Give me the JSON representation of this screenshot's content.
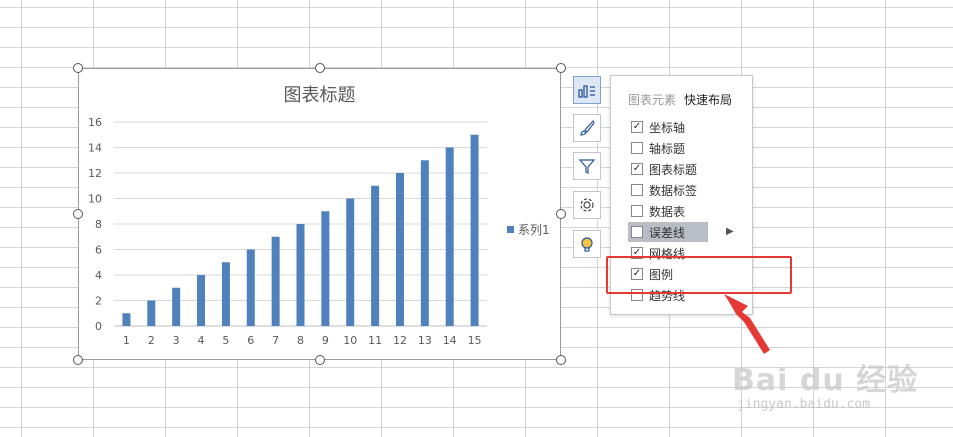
{
  "chart": {
    "title": "图表标题",
    "legend_label": "系列1"
  },
  "chart_data": {
    "type": "bar",
    "categories": [
      "1",
      "2",
      "3",
      "4",
      "5",
      "6",
      "7",
      "8",
      "9",
      "10",
      "11",
      "12",
      "13",
      "14",
      "15"
    ],
    "series": [
      {
        "name": "系列1",
        "values": [
          1,
          2,
          3,
          4,
          5,
          6,
          7,
          8,
          9,
          10,
          11,
          12,
          13,
          14,
          15
        ],
        "color": "#4f81bd"
      }
    ],
    "title": "图表标题",
    "xlabel": "",
    "ylabel": "",
    "ylim": [
      0,
      16
    ],
    "yticks": [
      0,
      2,
      4,
      6,
      8,
      10,
      12,
      14,
      16
    ],
    "grid": true,
    "legend": "right"
  },
  "side_tools": [
    {
      "name": "chart-elements-icon",
      "active": true
    },
    {
      "name": "chart-styles-brush-icon",
      "active": false
    },
    {
      "name": "chart-filter-icon",
      "active": false
    },
    {
      "name": "chart-settings-gear-icon",
      "active": false
    },
    {
      "name": "lightbulb-icon",
      "active": false
    }
  ],
  "panel": {
    "tabs": [
      {
        "label": "图表元素",
        "active": false
      },
      {
        "label": "快速布局",
        "active": true
      }
    ],
    "options": [
      {
        "label": "坐标轴",
        "checked": true
      },
      {
        "label": "轴标题",
        "checked": false
      },
      {
        "label": "图表标题",
        "checked": true
      },
      {
        "label": "数据标签",
        "checked": false
      },
      {
        "label": "数据表",
        "checked": false
      },
      {
        "label": "误差线",
        "checked": false,
        "hover": true
      },
      {
        "label": "网格线",
        "checked": true
      },
      {
        "label": "图例",
        "checked": true
      },
      {
        "label": "趋势线",
        "checked": false
      }
    ],
    "more_arrow": "▶",
    "check_mark": "✓"
  },
  "watermark": {
    "logo": "Bai du 经验",
    "url": "jingyan.baidu.com"
  },
  "colors": {
    "bar": "#4f81bd",
    "highlight": "#e53935",
    "gridline": "#d9d9d9"
  }
}
